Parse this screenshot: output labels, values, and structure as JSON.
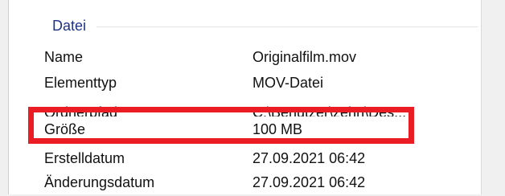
{
  "section": {
    "title": "Datei"
  },
  "rows": [
    {
      "label": "Name",
      "value": "Originalfilm.mov"
    },
    {
      "label": "Elementtyp",
      "value": "MOV-Datei"
    },
    {
      "label": "Ordnerpfad",
      "value": "C:\\Benutzer\\zehn\\Des..."
    },
    {
      "label": "Größe",
      "value": "100 MB"
    },
    {
      "label": "Erstelldatum",
      "value": "27.09.2021 06:42"
    },
    {
      "label": "Änderungsdatum",
      "value": "27.09.2021 06:42"
    }
  ],
  "annotation": {
    "color": "#ea1c24"
  }
}
